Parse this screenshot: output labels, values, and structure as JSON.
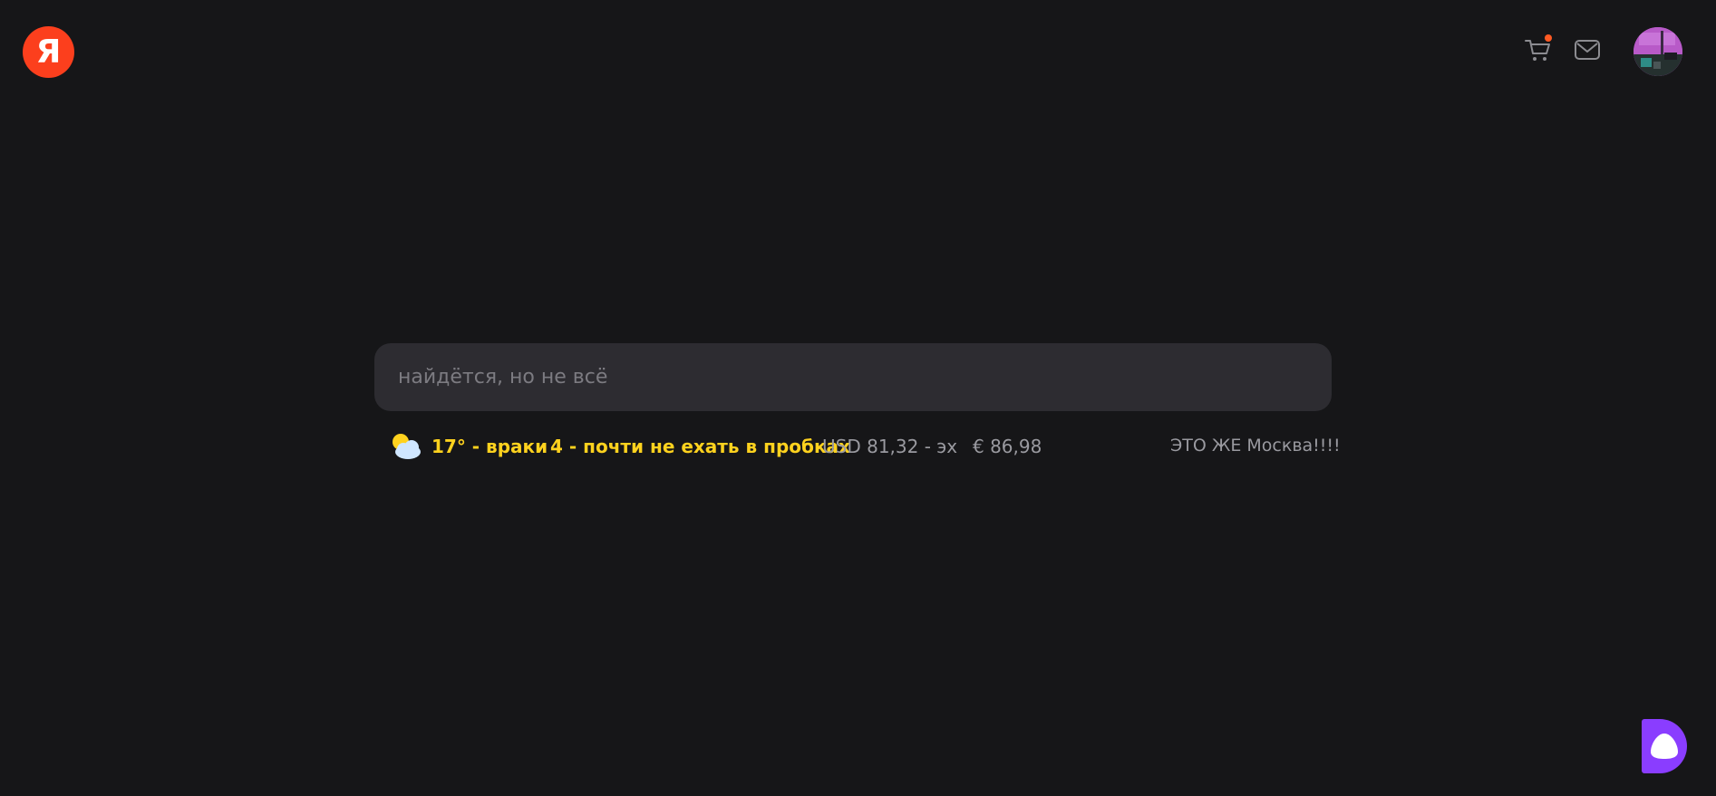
{
  "header": {
    "logo_letter": "Я",
    "logo_color": "#fc3f1d",
    "cart_icon": "cart-icon",
    "cart_badge_color": "#ff5a23",
    "mail_icon": "mail-icon",
    "avatar": "user-avatar"
  },
  "search": {
    "placeholder": "найдётся, но не всё",
    "value": ""
  },
  "info": {
    "weather_icon": "partly-cloudy-icon",
    "weather": "17° - враки",
    "traffic": "4 - почти не ехать в пробках",
    "usd": "USD 81,32 - эх",
    "eur": "€ 86,98",
    "city": "ЭТО ЖЕ Москва!!!!",
    "accent_color": "#ffd21e"
  },
  "alice": {
    "icon": "alice-assistant-icon",
    "color": "#8a3dff"
  }
}
